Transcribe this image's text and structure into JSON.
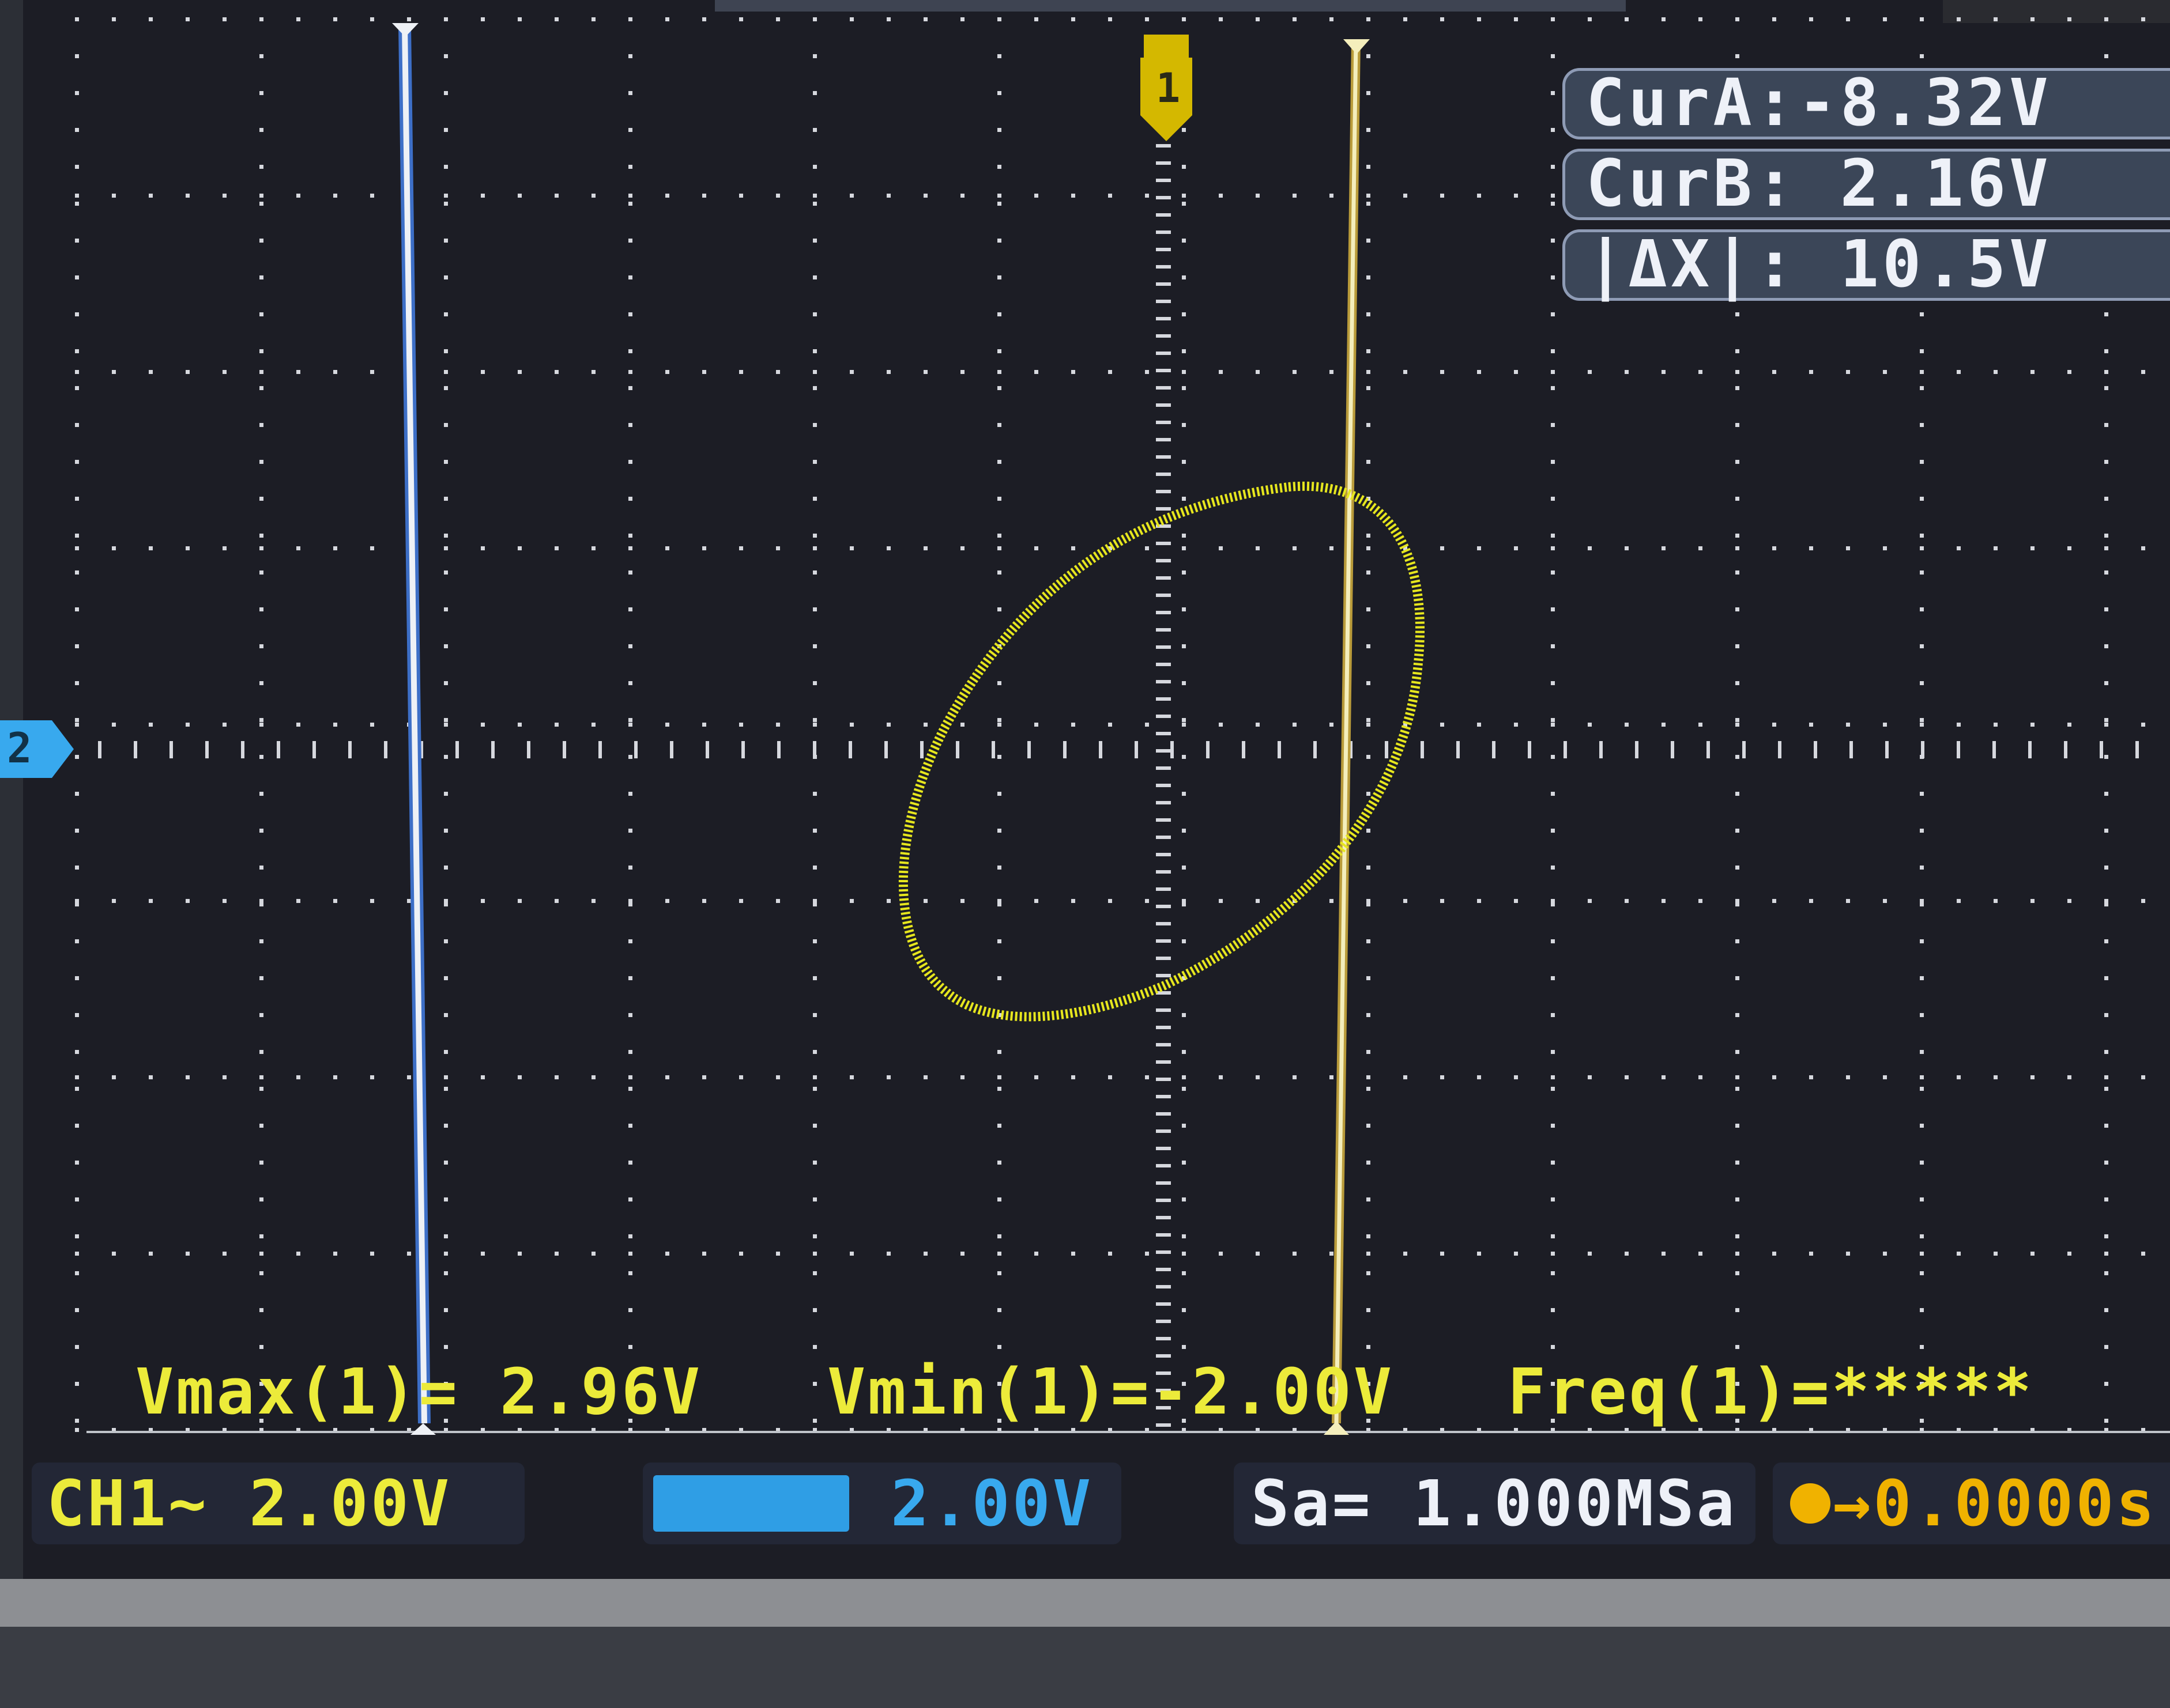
{
  "cursors": {
    "cur_a": "CurA:-8.32V",
    "cur_b": "CurB: 2.16V",
    "delta_x": "|ΔX|: 10.5V"
  },
  "measurements": {
    "vmax": "Vmax(1)= 2.96V",
    "vmin": "Vmin(1)=-2.00V",
    "freq": "Freq(1)=*****"
  },
  "status_bar": {
    "ch1": "CH1∼ 2.00V",
    "ch2_icon": "ch2-channel-icon",
    "ch2_value": "2.00V",
    "sample_rate": "Sa= 1.000MSa",
    "trigger_icon": "trigger-icon",
    "trigger_time": "→0.0000s"
  },
  "markers": {
    "channel1_marker": "1",
    "channel2_marker": "2"
  },
  "colors": {
    "trace": "#e6e61e",
    "cursor_a": "#e9edf3",
    "cursor_a_edge": "#3d6fc7",
    "cursor_b": "#f2ecb0",
    "grid": "#d6d8de",
    "ch2_accent": "#38a9ee",
    "cursor_box_bg": "#3b4658",
    "screen_bg": "#1c1d25"
  }
}
